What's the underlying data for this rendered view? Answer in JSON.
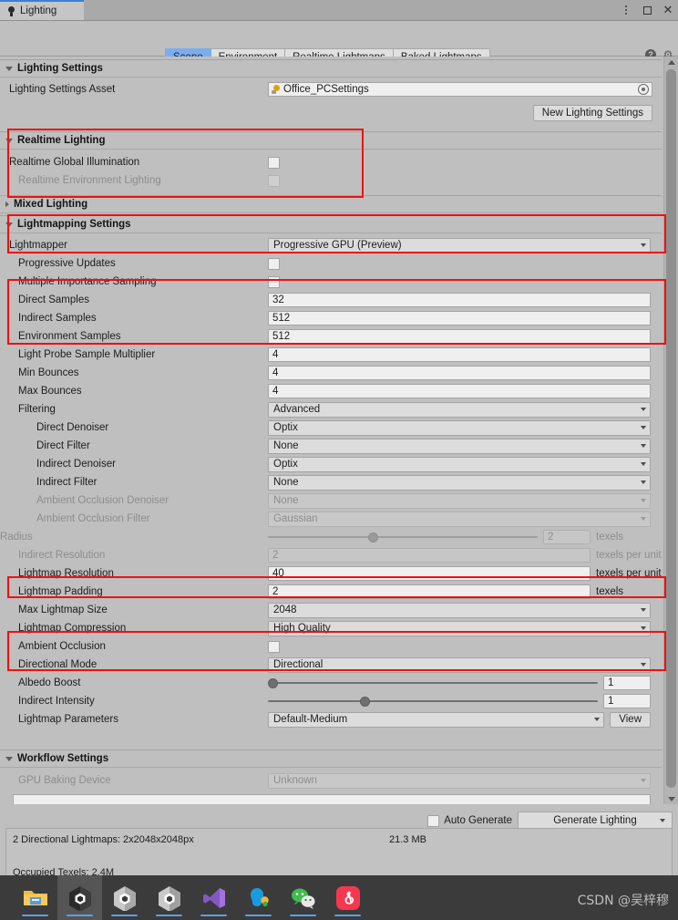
{
  "window": {
    "tab_title": "Lighting",
    "icon": "lightbulb-icon",
    "controls": {
      "menu": "kebab-menu-icon",
      "maximize": "maximize-icon",
      "close": "close-icon"
    }
  },
  "toolbar": {
    "tabs": [
      {
        "label": "Scene",
        "selected": true
      },
      {
        "label": "Environment",
        "selected": false
      },
      {
        "label": "Realtime Lightmaps",
        "selected": false
      },
      {
        "label": "Baked Lightmaps",
        "selected": false
      }
    ],
    "help_icon": "help-icon",
    "settings_icon": "gear-icon"
  },
  "sections": {
    "lighting_settings": {
      "title": "Lighting Settings",
      "asset_label": "Lighting Settings Asset",
      "asset_value": "Office_PCSettings",
      "new_button": "New Lighting Settings"
    },
    "realtime_lighting": {
      "title": "Realtime Lighting",
      "rows": [
        {
          "label": "Realtime Global Illumination",
          "value": "",
          "checked": false,
          "disabled": false
        },
        {
          "label": "Realtime Environment Lighting",
          "value": "",
          "checked": false,
          "disabled": true
        }
      ]
    },
    "mixed_lighting": {
      "title": "Mixed Lighting"
    },
    "lightmapping_settings": {
      "title": "Lightmapping Settings",
      "rows": [
        {
          "label": "Lightmapper",
          "value": "Progressive GPU (Preview)",
          "type": "dropdown",
          "indent": 0,
          "disabled": false
        },
        {
          "label": "Progressive Updates",
          "value": "",
          "type": "checkbox",
          "indent": 1,
          "disabled": false
        },
        {
          "label": "Multiple Importance Sampling",
          "value": "",
          "type": "checkbox",
          "indent": 1,
          "disabled": false
        },
        {
          "label": "Direct Samples",
          "value": "32",
          "type": "text",
          "indent": 1,
          "disabled": false
        },
        {
          "label": "Indirect Samples",
          "value": "512",
          "type": "text",
          "indent": 1,
          "disabled": false
        },
        {
          "label": "Environment Samples",
          "value": "512",
          "type": "text",
          "indent": 1,
          "disabled": false
        },
        {
          "label": "Light Probe Sample Multiplier",
          "value": "4",
          "type": "text",
          "indent": 1,
          "disabled": false
        },
        {
          "label": "Min Bounces",
          "value": "4",
          "type": "text",
          "indent": 1,
          "disabled": false
        },
        {
          "label": "Max Bounces",
          "value": "4",
          "type": "text",
          "indent": 1,
          "disabled": false
        },
        {
          "label": "Filtering",
          "value": "Advanced",
          "type": "dropdown",
          "indent": 1,
          "disabled": false
        },
        {
          "label": "Direct Denoiser",
          "value": "Optix",
          "type": "dropdown",
          "indent": 2,
          "disabled": false
        },
        {
          "label": "Direct Filter",
          "value": "None",
          "type": "dropdown",
          "indent": 2,
          "disabled": false
        },
        {
          "label": "Indirect Denoiser",
          "value": "Optix",
          "type": "dropdown",
          "indent": 2,
          "disabled": false
        },
        {
          "label": "Indirect Filter",
          "value": "None",
          "type": "dropdown",
          "indent": 2,
          "disabled": false
        },
        {
          "label": "Ambient Occlusion Denoiser",
          "value": "None",
          "type": "dropdown",
          "indent": 2,
          "disabled": true
        },
        {
          "label": "Ambient Occlusion Filter",
          "value": "Gaussian",
          "type": "dropdown",
          "indent": 2,
          "disabled": true
        },
        {
          "label": "Radius",
          "value": "2",
          "type": "slider",
          "unit": "texels",
          "indent": 3,
          "disabled": true,
          "knob_pct": 37
        },
        {
          "label": "Indirect Resolution",
          "value": "2",
          "type": "text",
          "unit": "texels per unit",
          "indent": 1,
          "disabled": true
        },
        {
          "label": "Lightmap Resolution",
          "value": "40",
          "type": "text",
          "unit": "texels per unit",
          "indent": 1,
          "disabled": false
        },
        {
          "label": "Lightmap Padding",
          "value": "2",
          "type": "text",
          "unit": "texels",
          "indent": 1,
          "disabled": false
        },
        {
          "label": "Max Lightmap Size",
          "value": "2048",
          "type": "dropdown",
          "indent": 1,
          "disabled": false
        },
        {
          "label": "Lightmap Compression",
          "value": "High Quality",
          "type": "dropdown",
          "indent": 1,
          "disabled": false
        },
        {
          "label": "Ambient Occlusion",
          "value": "",
          "type": "checkbox",
          "indent": 1,
          "disabled": false
        },
        {
          "label": "Directional Mode",
          "value": "Directional",
          "type": "dropdown",
          "indent": 1,
          "disabled": false
        },
        {
          "label": "Albedo Boost",
          "value": "1",
          "type": "slider-field",
          "indent": 1,
          "disabled": false,
          "knob_pct": 0
        },
        {
          "label": "Indirect Intensity",
          "value": "1",
          "type": "slider-field",
          "indent": 1,
          "disabled": false,
          "knob_pct": 28
        },
        {
          "label": "Lightmap Parameters",
          "value": "Default-Medium",
          "type": "dropdown-button",
          "button": "View",
          "indent": 1,
          "disabled": false
        }
      ]
    },
    "workflow_settings": {
      "title": "Workflow Settings",
      "rows": [
        {
          "label": "GPU Baking Device",
          "value": "Unknown",
          "type": "dropdown",
          "indent": 1,
          "disabled": true
        }
      ]
    }
  },
  "footer": {
    "auto_generate_label": "Auto Generate",
    "auto_generate_checked": false,
    "generate_button": "Generate Lighting",
    "stats": [
      "2 Directional Lightmaps: 2x2048x2048px",
      "21.3 MB",
      "Occupied Texels: 2.4M"
    ]
  },
  "taskbar": {
    "items": [
      {
        "name": "file-explorer-icon",
        "active": false
      },
      {
        "name": "unity-editor-icon",
        "active": true
      },
      {
        "name": "unity-hub-icon",
        "active": false
      },
      {
        "name": "unity-icon",
        "active": false
      },
      {
        "name": "visual-studio-icon",
        "active": false
      },
      {
        "name": "qq-icon",
        "active": false
      },
      {
        "name": "wechat-icon",
        "active": false
      },
      {
        "name": "netease-music-icon",
        "active": false
      }
    ],
    "watermark": "CSDN @吴梓穆"
  },
  "colors": {
    "accent": "#7cacec",
    "annotation": "#ee1111",
    "panel": "#bfbfbf"
  }
}
